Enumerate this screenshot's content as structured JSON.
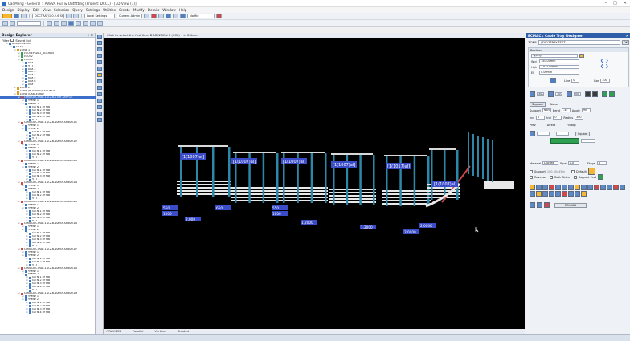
{
  "window": {
    "title": "CadMeng - General :: AVEVA Hull & Outfitting (Project: DCCL) - [3D View (1)]",
    "controls": [
      "–",
      "□",
      "✕"
    ]
  },
  "menu": [
    "Design",
    "Display",
    "Edit",
    "View",
    "Selection",
    "Query",
    "Settings",
    "Utilities",
    "Create",
    "Modify",
    "Details",
    "Window",
    "Help"
  ],
  "toolbar": {
    "combo_project": "DCCTRAY/1.0.2.6 SHIP-01",
    "combo_settings": "Local Settings",
    "combo_element": "Current Admin",
    "combo_file": "No file"
  },
  "explorer": {
    "title": "Design Explorer",
    "filter_label": "Filter",
    "filter_checkbox": "Saved Fol",
    "nodes": [
      {
        "t": "Design: WORL *",
        "d": 1,
        "ic": "#3a79c9"
      },
      {
        "t": "SITE /",
        "d": 2,
        "ic": "#3a79c9"
      },
      {
        "t": "ZONE 1",
        "d": 3,
        "ic": "#e09a1a"
      },
      {
        "t": "EQUI EPS001_BOXHAN",
        "d": 4,
        "ic": "#3aa05a"
      },
      {
        "t": "EQUI 2",
        "d": 4,
        "ic": "#3aa05a"
      },
      {
        "t": "EQUI 3",
        "d": 4,
        "ic": "#3aa05a"
      },
      {
        "t": "BOX 1",
        "d": 5,
        "ic": "#3a79c9"
      },
      {
        "t": "FITT 1",
        "d": 5,
        "ic": "#3a79c9"
      },
      {
        "t": "BOX 2",
        "d": 5,
        "ic": "#3a79c9"
      },
      {
        "t": "BOX 3",
        "d": 5,
        "ic": "#3a79c9"
      },
      {
        "t": "BOX 4",
        "d": 5,
        "ic": "#3a79c9"
      },
      {
        "t": "BOX 5",
        "d": 5,
        "ic": "#3a79c9"
      },
      {
        "t": "BOX 6",
        "d": 5,
        "ic": "#3a79c9"
      },
      {
        "t": "BOX 7",
        "d": 5,
        "ic": "#3a79c9"
      },
      {
        "t": "ZONE 2",
        "d": 3,
        "ic": "#e09a1a"
      },
      {
        "t": "ZONE /ROUTING/SETTINGS",
        "d": 3,
        "ic": "#e09a1a"
      },
      {
        "t": "ZONE /CABLETRAY",
        "d": 3,
        "ic": "#e09a1a"
      },
      {
        "t": "STRU DCCTRAY-1.0.2.6-STHF-SHIP-01",
        "d": 4,
        "ic": "#d04848",
        "hl": true
      },
      {
        "t": "FRMW 1",
        "d": 5,
        "ic": "#3a79c9"
      },
      {
        "t": "FRMW 2",
        "d": 5,
        "ic": "#3a79c9"
      },
      {
        "t": "SCTN 1 of fab",
        "d": 6,
        "ic": "#3a79c9"
      },
      {
        "t": "SCTN 2 of fab",
        "d": 6,
        "ic": "#3a79c9"
      },
      {
        "t": "SCTN 3 of fab",
        "d": 6,
        "ic": "#3a79c9"
      },
      {
        "t": "SCTN 4 of fab",
        "d": 6,
        "ic": "#3a79c9"
      },
      {
        "t": "FITT 1",
        "d": 6,
        "ic": "#3a79c9"
      },
      {
        "t": "STRU DCCTRAY-1.0.2.6-100SP-SH800-01",
        "d": 4,
        "ic": "#d04848"
      },
      {
        "t": "FRMW 1",
        "d": 5,
        "ic": "#3a79c9"
      },
      {
        "t": "FRMW 2",
        "d": 5,
        "ic": "#3a79c9"
      },
      {
        "t": "SCTN 1 of fab",
        "d": 6,
        "ic": "#3a79c9"
      },
      {
        "t": "SCTN 2 of fab",
        "d": 6,
        "ic": "#3a79c9"
      },
      {
        "t": "FITT 1",
        "d": 6,
        "ic": "#3a79c9"
      },
      {
        "t": "STRU DCCTRAY-1.0.2.6-100SP-SH800-02",
        "d": 4,
        "ic": "#d04848"
      },
      {
        "t": "FRMW 1",
        "d": 5,
        "ic": "#3a79c9"
      },
      {
        "t": "FRMW 2",
        "d": 5,
        "ic": "#3a79c9"
      },
      {
        "t": "SCTN 1 of fab",
        "d": 6,
        "ic": "#3a79c9"
      },
      {
        "t": "SCTN 2 of fab",
        "d": 6,
        "ic": "#3a79c9"
      },
      {
        "t": "FITT 1",
        "d": 6,
        "ic": "#3a79c9"
      },
      {
        "t": "STRU DCCTRAY-1.0.2.6-100SP-SH800-03",
        "d": 4,
        "ic": "#d04848"
      },
      {
        "t": "FRMW 1",
        "d": 5,
        "ic": "#3a79c9"
      },
      {
        "t": "FRMW 2",
        "d": 5,
        "ic": "#3a79c9"
      },
      {
        "t": "SCTN 1 of fab",
        "d": 6,
        "ic": "#3a79c9"
      },
      {
        "t": "SCTN 2 of fab",
        "d": 6,
        "ic": "#3a79c9"
      },
      {
        "t": "SCTN 3 of fab",
        "d": 6,
        "ic": "#3a79c9"
      },
      {
        "t": "FITT 1",
        "d": 6,
        "ic": "#3a79c9"
      },
      {
        "t": "STRU DCCTRAY-1.0.2.6-100SP-SH800-04",
        "d": 4,
        "ic": "#d04848"
      },
      {
        "t": "FRMW 1",
        "d": 5,
        "ic": "#3a79c9"
      },
      {
        "t": "FRMW 2",
        "d": 5,
        "ic": "#3a79c9"
      },
      {
        "t": "SCTN 1 of fab",
        "d": 6,
        "ic": "#3a79c9"
      },
      {
        "t": "SCTN 2 of fab",
        "d": 6,
        "ic": "#3a79c9"
      },
      {
        "t": "FITT 1",
        "d": 6,
        "ic": "#3a79c9"
      },
      {
        "t": "STRU DCCTRAY-1.0.2.6-100SP-SH800-05",
        "d": 4,
        "ic": "#d04848"
      },
      {
        "t": "FRMW 1",
        "d": 5,
        "ic": "#3a79c9"
      },
      {
        "t": "FRMW 2",
        "d": 5,
        "ic": "#3a79c9"
      },
      {
        "t": "SCTN 1 of fab",
        "d": 6,
        "ic": "#3a79c9"
      },
      {
        "t": "SCTN 2 of fab",
        "d": 6,
        "ic": "#3a79c9"
      },
      {
        "t": "SCTN 3 of fab",
        "d": 6,
        "ic": "#3a79c9"
      },
      {
        "t": "FITT 1",
        "d": 6,
        "ic": "#3a79c9"
      },
      {
        "t": "STRU DCCTRAY-1.0.2.6-100SP-SH800-06",
        "d": 4,
        "ic": "#d04848"
      },
      {
        "t": "FRMW 1",
        "d": 5,
        "ic": "#3a79c9"
      },
      {
        "t": "FRMW 2",
        "d": 5,
        "ic": "#3a79c9"
      },
      {
        "t": "SCTN 1 of fab",
        "d": 6,
        "ic": "#3a79c9"
      },
      {
        "t": "SCTN 2 of fab",
        "d": 6,
        "ic": "#3a79c9"
      },
      {
        "t": "SCTN 3 of fab",
        "d": 6,
        "ic": "#3a79c9"
      },
      {
        "t": "SCTN 4 of fab",
        "d": 6,
        "ic": "#3a79c9"
      },
      {
        "t": "FITT 1",
        "d": 6,
        "ic": "#3a79c9"
      },
      {
        "t": "STRU DCCTRAY-1.0.2.6-100SP-SH800-07",
        "d": 4,
        "ic": "#d04848"
      },
      {
        "t": "FRMW 1",
        "d": 5,
        "ic": "#3a79c9"
      },
      {
        "t": "FRMW 2",
        "d": 5,
        "ic": "#3a79c9"
      },
      {
        "t": "SCTN 1 of fab",
        "d": 6,
        "ic": "#3a79c9"
      },
      {
        "t": "SCTN 2 of fab",
        "d": 6,
        "ic": "#3a79c9"
      },
      {
        "t": "FITT 1",
        "d": 6,
        "ic": "#3a79c9"
      },
      {
        "t": "STRU DCCTRAY-1.0.2.6-100SP-SH800-08",
        "d": 4,
        "ic": "#d04848"
      },
      {
        "t": "FRMW 1",
        "d": 5,
        "ic": "#3a79c9"
      },
      {
        "t": "FRMW 2",
        "d": 5,
        "ic": "#3a79c9"
      },
      {
        "t": "SCTN 1 of fab",
        "d": 6,
        "ic": "#3a79c9"
      },
      {
        "t": "SCTN 2 of fab",
        "d": 6,
        "ic": "#3a79c9"
      },
      {
        "t": "SCTN 3 of fab",
        "d": 6,
        "ic": "#3a79c9"
      },
      {
        "t": "SCTN 4 of fab",
        "d": 6,
        "ic": "#3a79c9"
      },
      {
        "t": "FITT 1",
        "d": 6,
        "ic": "#3a79c9"
      },
      {
        "t": "STRU DCCTRAY-1.0.2.6-100SP-SH800-09",
        "d": 4,
        "ic": "#d04848"
      },
      {
        "t": "FRMW 1",
        "d": 5,
        "ic": "#3a79c9"
      },
      {
        "t": "FRMW 2",
        "d": 5,
        "ic": "#3a79c9"
      },
      {
        "t": "SCTN 1 of fab",
        "d": 6,
        "ic": "#3a79c9"
      },
      {
        "t": "SCTN 2 of fab",
        "d": 6,
        "ic": "#3a79c9"
      },
      {
        "t": "SCTN 3 of fab",
        "d": 6,
        "ic": "#3a79c9"
      },
      {
        "t": "SCTN 4 of fab",
        "d": 6,
        "ic": "#3a79c9"
      }
    ]
  },
  "viewport": {
    "caption": "Click to select the first Item  DIMENSION 0 (CCL) • in 8 items",
    "status": [
      "-TRAY-232",
      "Parallel",
      "Vertical",
      "Shaded"
    ],
    "labels": [
      "[1(1007)al]",
      "[1(1007)al]",
      "[1(1007)al]",
      "[1(1007)al]",
      "[1(1017)al]",
      "[1(1007)al]"
    ],
    "tags": [
      "550",
      "1000",
      "650",
      "2,000",
      "550",
      "1000",
      "1,2000",
      "1,2000",
      "2,0000",
      "2,0000"
    ]
  },
  "cable_designer": {
    "title": "ECMAC : Cable Tray Designer",
    "zone_label": "ZONE",
    "zone_value": "/ZA07TRAY-TEST",
    "zone_button": "OK",
    "position_title": "Position",
    "type_value": "Type@",
    "width_label": "Wid",
    "width_value": "150.00mm",
    "height_label": "Hgh",
    "height_value": "1100.00mm",
    "elev_label": "El",
    "elev_value": "0.00mm",
    "spec_label": "Line",
    "spec_value": "0",
    "bore_label": "Bor",
    "bore_value": "300",
    "size_a": "300",
    "size_b": "300",
    "size_c": "00",
    "support_label": "Support",
    "support_value": "None",
    "bend_label": "Bend",
    "bend_value": "-35",
    "angle_label": "Angle",
    "angle_value": "90",
    "incl_label": "Incl",
    "incl_value": "0",
    "radius_label": "Radius",
    "radius_value": "300",
    "row_labels": [
      "Prev",
      "Direct",
      "Fill top",
      "Square"
    ],
    "material_label": "Material",
    "material_value": "Ducted",
    "pipe_label": "Pipe",
    "pipe_value": "0.0",
    "stage_label": "Stage",
    "stage_value": "4",
    "support_check": "Support",
    "support_value2": "100.00x45m",
    "default_check": "Default",
    "reverse_check": "Reverse",
    "bothsides_check": "Both Sides",
    "supportfeet_check": "Support Feet",
    "reload_button": "RELOAD"
  }
}
